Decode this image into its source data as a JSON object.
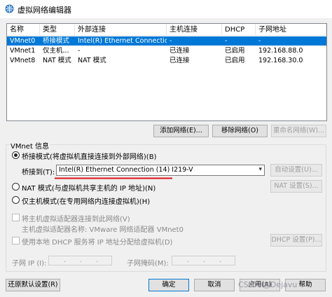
{
  "window": {
    "title": "虚拟网络编辑器"
  },
  "table": {
    "columns": [
      "名称",
      "类型",
      "外部连接",
      "主机连接",
      "DHCP",
      "子网地址"
    ],
    "rows": [
      [
        "VMnet0",
        "桥接模式",
        "Intel(R) Ethernet Connectio...",
        "-",
        "-",
        "-"
      ],
      [
        "VMnet1",
        "仅主机...",
        "-",
        "已连接",
        "已启用",
        "192.168.88.0"
      ],
      [
        "VMnet8",
        "NAT 模式",
        "NAT 模式",
        "已连接",
        "已启用",
        "192.168.30.0"
      ]
    ],
    "selected_row": 0
  },
  "network_buttons": {
    "add": "添加网络(E)...",
    "remove": "移除网络(O)",
    "rename": "重命名网络(W)..."
  },
  "info": {
    "group_title": "VMnet 信息",
    "bridge_label": "桥接模式(将虚拟机直接连接到外部网络)(B)",
    "bridge_to_label": "桥接到(T):",
    "bridge_to_value": "Intel(R) Ethernet Connection (14) I219-V",
    "auto_settings": "自动设置(U)...",
    "nat_label": "NAT 模式(与虚拟机共享主机的 IP 地址)(N)",
    "nat_settings": "NAT 设置(S)...",
    "host_only_label": "仅主机模式(在专用网络内连接虚拟机)(H)",
    "connect_adapter_label": "将主机虚拟适配器连接到此网络(V)",
    "adapter_name_label": "主机虚拟适配器名称: VMware 网络适配器 VMnet0",
    "dhcp_label": "使用本地 DHCP 服务将 IP 地址分配给虚拟机(D)",
    "dhcp_settings": "DHCP 设置(P)...",
    "subnet_ip_label": "子网 IP (I):",
    "subnet_mask_label": "子网掩码(M):",
    "bridge_selected": true
  },
  "bottom_buttons": {
    "restore": "还原默认设置(R)",
    "ok": "确定",
    "cancel": "取消",
    "apply": "应用(A)",
    "help": "帮助"
  },
  "watermark": "CSDN @Dejavu",
  "colors": {
    "selection": "#0078d7",
    "annotation": "#e0101a"
  }
}
